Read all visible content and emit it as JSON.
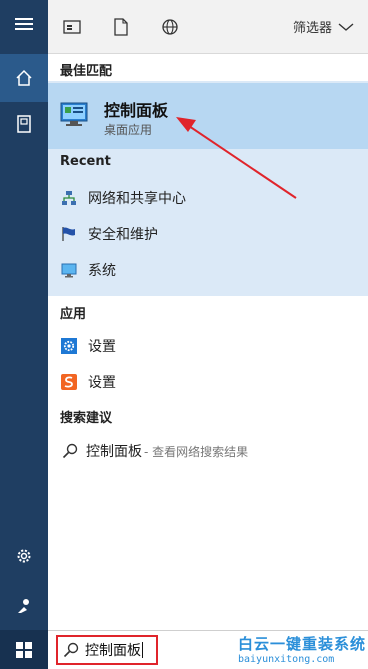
{
  "toolbar": {
    "filter_label": "筛选器"
  },
  "best_match": {
    "title": "最佳匹配",
    "item": {
      "name": "控制面板",
      "sub": "桌面应用"
    }
  },
  "recent": {
    "title": "Recent",
    "items": [
      {
        "label": "网络和共享中心",
        "icon": "network-icon"
      },
      {
        "label": "安全和维护",
        "icon": "flag-icon"
      },
      {
        "label": "系统",
        "icon": "monitor-icon"
      }
    ]
  },
  "apps": {
    "title": "应用",
    "items": [
      {
        "label": "设置",
        "icon": "settings-gear-icon"
      },
      {
        "label": "设置",
        "icon": "sogou-icon"
      }
    ]
  },
  "suggestions": {
    "title": "搜索建议",
    "query": "控制面板",
    "rest": "- 查看网络搜索结果"
  },
  "search": {
    "value": "控制面板"
  },
  "watermark": {
    "line1": "白云一键重装系统",
    "line2": "baiyunxitong.com"
  },
  "colors": {
    "rail": "#1f3e62",
    "rail_active": "#2b5a8b",
    "highlight": "#b7d7f2",
    "section_bg": "#dbe9f7",
    "annotation_red": "#e0242b"
  }
}
